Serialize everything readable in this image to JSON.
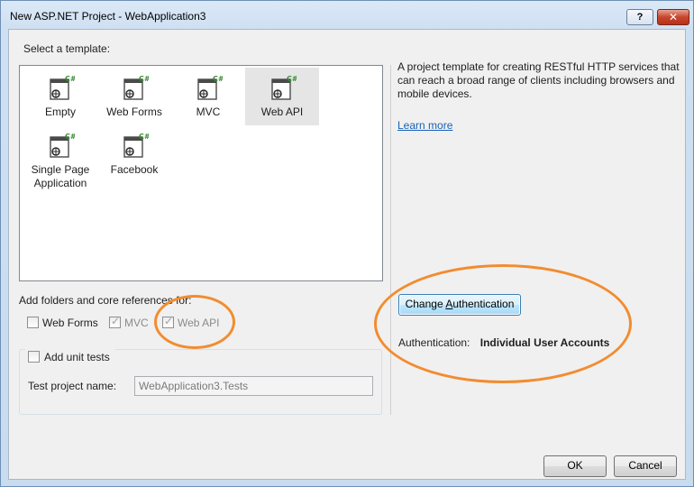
{
  "window": {
    "title": "New ASP.NET Project - WebApplication3",
    "help_label": "?",
    "close_label": "✕"
  },
  "templates": {
    "section_label": "Select a template:",
    "items": [
      {
        "label": "Empty",
        "selected": false
      },
      {
        "label": "Web Forms",
        "selected": false
      },
      {
        "label": "MVC",
        "selected": false
      },
      {
        "label": "Web API",
        "selected": true
      },
      {
        "label": "Single Page Application",
        "selected": false
      },
      {
        "label": "Facebook",
        "selected": false
      }
    ],
    "icon_badge": "C#"
  },
  "description": {
    "text": "A project template for creating RESTful HTTP services that can reach a broad range of clients including browsers and mobile devices.",
    "learn_more": "Learn more"
  },
  "references": {
    "section_label": "Add folders and core references for:",
    "web_forms": {
      "label": "Web Forms",
      "checked": false,
      "enabled": true
    },
    "mvc": {
      "label": "MVC",
      "checked": true,
      "enabled": false
    },
    "web_api": {
      "label": "Web API",
      "checked": true,
      "enabled": false
    }
  },
  "unit_tests": {
    "label": "Add unit tests",
    "checked": false,
    "project_name_label": "Test project name:",
    "project_name_value": "WebApplication3.Tests"
  },
  "authentication": {
    "change_button_prefix": "Change ",
    "change_button_accel": "A",
    "change_button_suffix": "uthentication",
    "label": "Authentication:",
    "value": "Individual User Accounts"
  },
  "footer": {
    "ok_label": "OK",
    "cancel_label": "Cancel"
  },
  "colors": {
    "annotation": "#f28c30",
    "link": "#1a63b5"
  }
}
